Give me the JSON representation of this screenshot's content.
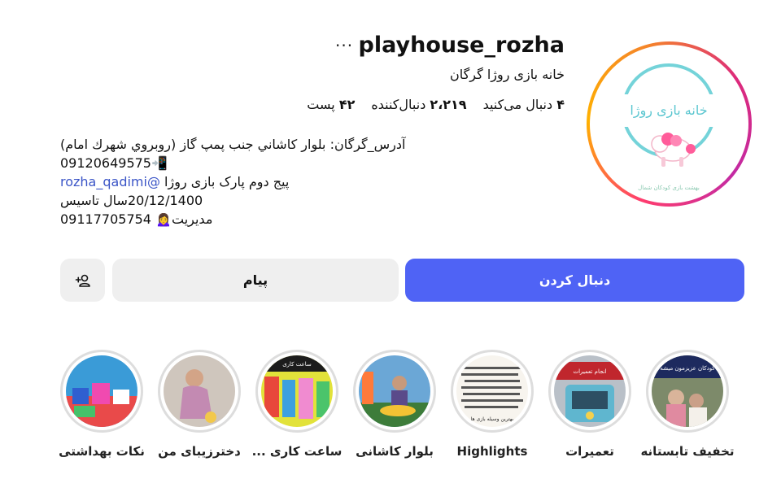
{
  "profile": {
    "username": "playhouse_rozha",
    "more": "···",
    "full_name": "خانه بازی روژا گرگان",
    "avatar_text": "خانه بازی روژا",
    "avatar_footer": "بهشت بازی کودکان شمال"
  },
  "stats": {
    "posts_value": "۴۲",
    "posts_label": "پست",
    "followers_value": "۲،۲۱۹",
    "followers_label": "دنبال‌کننده",
    "following_value": "۴",
    "following_label": "دنبال می‌کنید"
  },
  "bio": {
    "line1": "آدرس_گرگان: بلوار کاشاني جنب پمپ گاز (روبروي شهرك امام)",
    "line2": "09120649575📲",
    "line3_text": "پیج دوم پارک بازی روژا",
    "line3_link": "@rozha_qadimi",
    "line4": "20/12/1400سال تاسیس",
    "line5": "09117705754 🙍‍♀️مدیریت"
  },
  "buttons": {
    "follow": "دنبال کردن",
    "message": "پیام",
    "suggest_icon": "add-person-icon"
  },
  "highlights": [
    {
      "label": "تخفیف تابستانه",
      "overlay": "کودکان عزیزمون میشه"
    },
    {
      "label": "تعمیرات",
      "overlay": "انجام تعمیرات"
    },
    {
      "label": "Highlights",
      "overlay": "بهترین وسیله بازی ها"
    },
    {
      "label": "بلوار کاشانی",
      "overlay": ""
    },
    {
      "label": "ساعت کاری ...",
      "overlay": "ساعت کاری"
    },
    {
      "label": "دخترزیبای من",
      "overlay": ""
    },
    {
      "label": "نکات بهداشتی",
      "overlay": ""
    }
  ],
  "colors": {
    "accent": "#4f63f5",
    "link": "#3b55c7",
    "button_bg": "#efefef"
  }
}
